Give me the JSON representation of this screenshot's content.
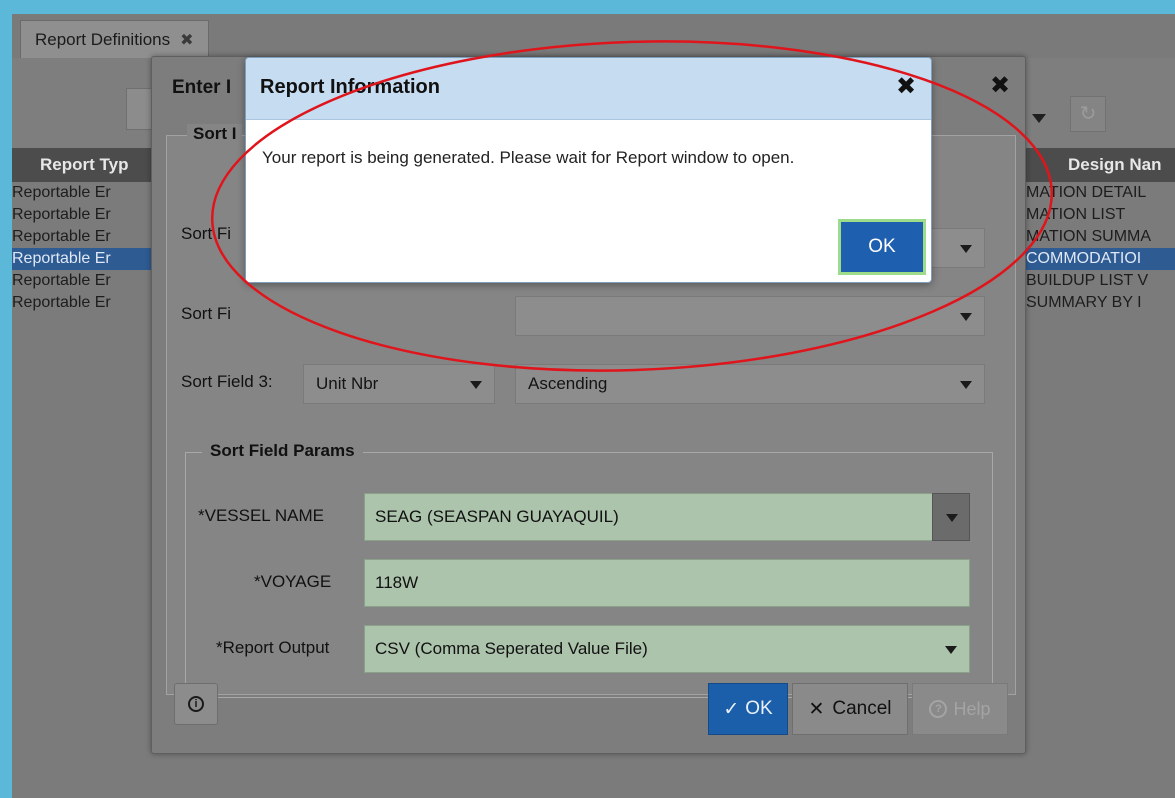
{
  "tabs": [
    {
      "label": "Report Definitions"
    }
  ],
  "grid": {
    "col_report_type": "Report Typ",
    "col_design_name": "Design Nan",
    "rows": [
      {
        "type": "Reportable Er",
        "design": "MATION DETAIL"
      },
      {
        "type": "Reportable Er",
        "design": "MATION LIST"
      },
      {
        "type": "Reportable Er",
        "design": "MATION SUMMA"
      },
      {
        "type": "Reportable Er",
        "design": "COMMODATIOI"
      },
      {
        "type": "Reportable Er",
        "design": "BUILDUP LIST V"
      },
      {
        "type": "Reportable Er",
        "design": "SUMMARY BY I"
      }
    ]
  },
  "dialog": {
    "title": "Enter I",
    "sort_legend": "Sort I",
    "sort_field_1_label": "Sort Fi",
    "sort_field_2_label": "Sort Fi",
    "sort_field_3_label": "Sort Field 3:",
    "sort_field_3_value": "Unit Nbr",
    "sort_field_3_order": "Ascending",
    "params_legend": "Sort Field Params",
    "vessel_label": "*VESSEL NAME",
    "vessel_value": "SEAG (SEASPAN GUAYAQUIL)",
    "voyage_label": "*VOYAGE",
    "voyage_value": "118W",
    "output_label": "*Report Output",
    "output_value": "CSV (Comma Seperated Value File)",
    "ok_label": "OK",
    "cancel_label": "Cancel",
    "help_label": "Help"
  },
  "popup": {
    "title": "Report Information",
    "message": "Your report is being generated. Please wait for Report window to open.",
    "ok_label": "OK"
  },
  "colors": {
    "outer_background": "#5bb8d8",
    "primary_button": "#1b5ea9",
    "selected_row": "#2f5b93",
    "required_field": "#acc3ac",
    "annotation": "#e0141b",
    "popup_header": "#c5dcf1"
  },
  "icons": {
    "close": "close-icon",
    "info": "info-icon",
    "help": "help-icon",
    "check": "check-icon",
    "cancel": "x-icon",
    "refresh": "refresh-icon"
  }
}
